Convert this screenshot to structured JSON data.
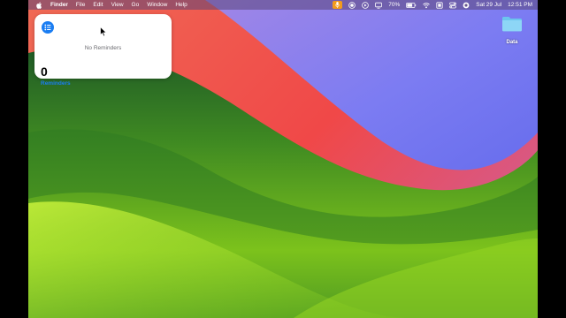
{
  "menubar": {
    "apple_icon": "apple-logo-icon",
    "app_name": "Finder",
    "menus": [
      "File",
      "Edit",
      "View",
      "Go",
      "Window",
      "Help"
    ],
    "battery_percent": "70%",
    "date": "Sat 29 Jul",
    "time": "12:51 PM",
    "status_icons": [
      "microphone-icon",
      "record-icon",
      "play-icon",
      "display-icon",
      "battery-icon",
      "wifi-icon",
      "control-center-icon",
      "screen-icon",
      "siri-icon"
    ]
  },
  "widget": {
    "icon": "list-bullet-icon",
    "empty_text": "No Reminders",
    "count": "0",
    "list_name": "Reminders",
    "accent_color": "#1a7df2"
  },
  "desktop": {
    "folder_label": "Data",
    "folder_icon": "folder-icon"
  },
  "colors": {
    "wallpaper_green": "#5aa61f",
    "wallpaper_red": "#f04a48",
    "wallpaper_blue": "#6d6df0"
  }
}
